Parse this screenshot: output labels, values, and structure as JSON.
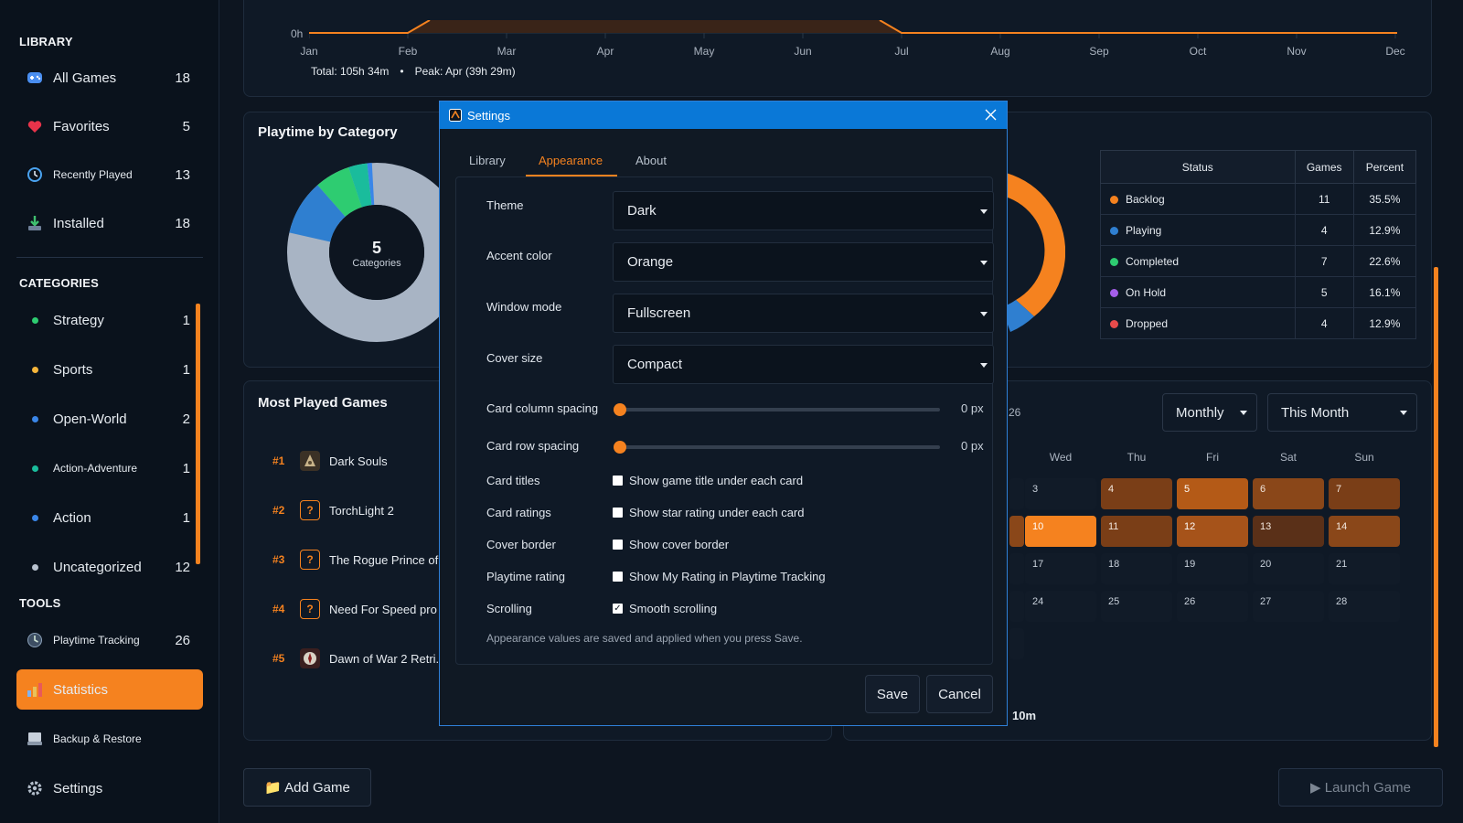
{
  "sidebar": {
    "library_heading": "LIBRARY",
    "library_items": [
      {
        "label": "All Games",
        "count": "18",
        "icon": "gamepad-icon"
      },
      {
        "label": "Favorites",
        "count": "5",
        "icon": "heart-icon"
      },
      {
        "label": "Recently Played",
        "count": "13",
        "icon": "history-icon"
      },
      {
        "label": "Installed",
        "count": "18",
        "icon": "download-icon"
      }
    ],
    "categories_heading": "CATEGORIES",
    "categories": [
      {
        "label": "Strategy",
        "count": "1",
        "color": "#2ecc71"
      },
      {
        "label": "Sports",
        "count": "1",
        "color": "#f5b53b"
      },
      {
        "label": "Open-World",
        "count": "2",
        "color": "#3a86e8"
      },
      {
        "label": "Action-Adventure",
        "count": "1",
        "color": "#1abc9c"
      },
      {
        "label": "Action",
        "count": "1",
        "color": "#3a86e8"
      },
      {
        "label": "Uncategorized",
        "count": "12",
        "color": "#b8c2cf"
      }
    ],
    "tools_heading": "TOOLS",
    "tools": [
      {
        "label": "Playtime Tracking",
        "count": "26",
        "icon": "clock-icon"
      },
      {
        "label": "Statistics",
        "count": "",
        "icon": "bar-chart-icon",
        "active": true
      },
      {
        "label": "Backup & Restore",
        "count": "",
        "icon": "drive-icon"
      },
      {
        "label": "Settings",
        "count": "",
        "icon": "gear-icon"
      }
    ]
  },
  "timeline": {
    "y_tick": "0h",
    "months": [
      "Jan",
      "Feb",
      "Mar",
      "Apr",
      "May",
      "Jun",
      "Jul",
      "Aug",
      "Sep",
      "Oct",
      "Nov",
      "Dec"
    ],
    "total": "Total: 105h 34m",
    "separator": "•",
    "peak": "Peak: Apr (39h 29m)"
  },
  "playtime_by_category": {
    "title": "Playtime by Category",
    "center_value": "5",
    "center_label": "Categories"
  },
  "status_table": {
    "headers": [
      "Status",
      "Games",
      "Percent"
    ],
    "rows": [
      {
        "status": "Backlog",
        "games": "11",
        "percent": "35.5%",
        "color": "#f5821f"
      },
      {
        "status": "Playing",
        "games": "4",
        "percent": "12.9%",
        "color": "#2f7fd0"
      },
      {
        "status": "Completed",
        "games": "7",
        "percent": "22.6%",
        "color": "#2ecc71"
      },
      {
        "status": "On Hold",
        "games": "5",
        "percent": "16.1%",
        "color": "#a55eea"
      },
      {
        "status": "Dropped",
        "games": "4",
        "percent": "12.9%",
        "color": "#e84b4b"
      }
    ]
  },
  "most_played": {
    "title": "Most Played Games",
    "items": [
      {
        "rank": "#1",
        "name": "Dark Souls",
        "icon": "game-cover-icon"
      },
      {
        "rank": "#2",
        "name": "TorchLight 2",
        "icon": "question-icon"
      },
      {
        "rank": "#3",
        "name": "The Rogue Prince of",
        "icon": "question-icon"
      },
      {
        "rank": "#4",
        "name": "Need For Speed pro",
        "icon": "question-icon"
      },
      {
        "rank": "#5",
        "name": "Dawn of War 2 Retri.",
        "icon": "game-cover-icon"
      }
    ]
  },
  "calendar": {
    "partial_label": "26",
    "period_select": "Monthly",
    "range_select": "This Month",
    "weekdays": [
      "Wed",
      "Thu",
      "Fri",
      "Sat",
      "Sun"
    ],
    "rows": [
      [
        "3",
        "4",
        "5",
        "6",
        "7"
      ],
      [
        "10",
        "11",
        "12",
        "13",
        "14"
      ],
      [
        "17",
        "18",
        "19",
        "20",
        "21"
      ],
      [
        "24",
        "25",
        "26",
        "27",
        "28"
      ]
    ],
    "footer_partial": "10m"
  },
  "bottom": {
    "add_game": "📁 Add Game",
    "launch_game": "▶ Launch Game"
  },
  "dialog": {
    "title": "Settings",
    "tabs": [
      "Library",
      "Appearance",
      "About"
    ],
    "active_tab": "Appearance",
    "theme_label": "Theme",
    "theme_value": "Dark",
    "accent_label": "Accent color",
    "accent_value": "Orange",
    "window_label": "Window mode",
    "window_value": "Fullscreen",
    "cover_label": "Cover size",
    "cover_value": "Compact",
    "col_spacing_label": "Card column spacing",
    "col_spacing_value": "0 px",
    "row_spacing_label": "Card row spacing",
    "row_spacing_value": "0 px",
    "card_titles_label": "Card titles",
    "card_titles_text": "Show game title under each card",
    "card_titles_checked": false,
    "card_ratings_label": "Card ratings",
    "card_ratings_text": "Show star rating under each card",
    "card_ratings_checked": false,
    "cover_border_label": "Cover border",
    "cover_border_text": "Show cover border",
    "cover_border_checked": false,
    "playtime_rating_label": "Playtime rating",
    "playtime_rating_text": "Show My Rating in Playtime Tracking",
    "playtime_rating_checked": false,
    "scrolling_label": "Scrolling",
    "scrolling_text": "Smooth scrolling",
    "scrolling_checked": true,
    "note": "Appearance values are saved and applied when you press Save.",
    "save": "Save",
    "cancel": "Cancel"
  },
  "colors": {
    "accent": "#f5821f",
    "titlebar": "#0a78d7",
    "background": "#0d1520"
  }
}
